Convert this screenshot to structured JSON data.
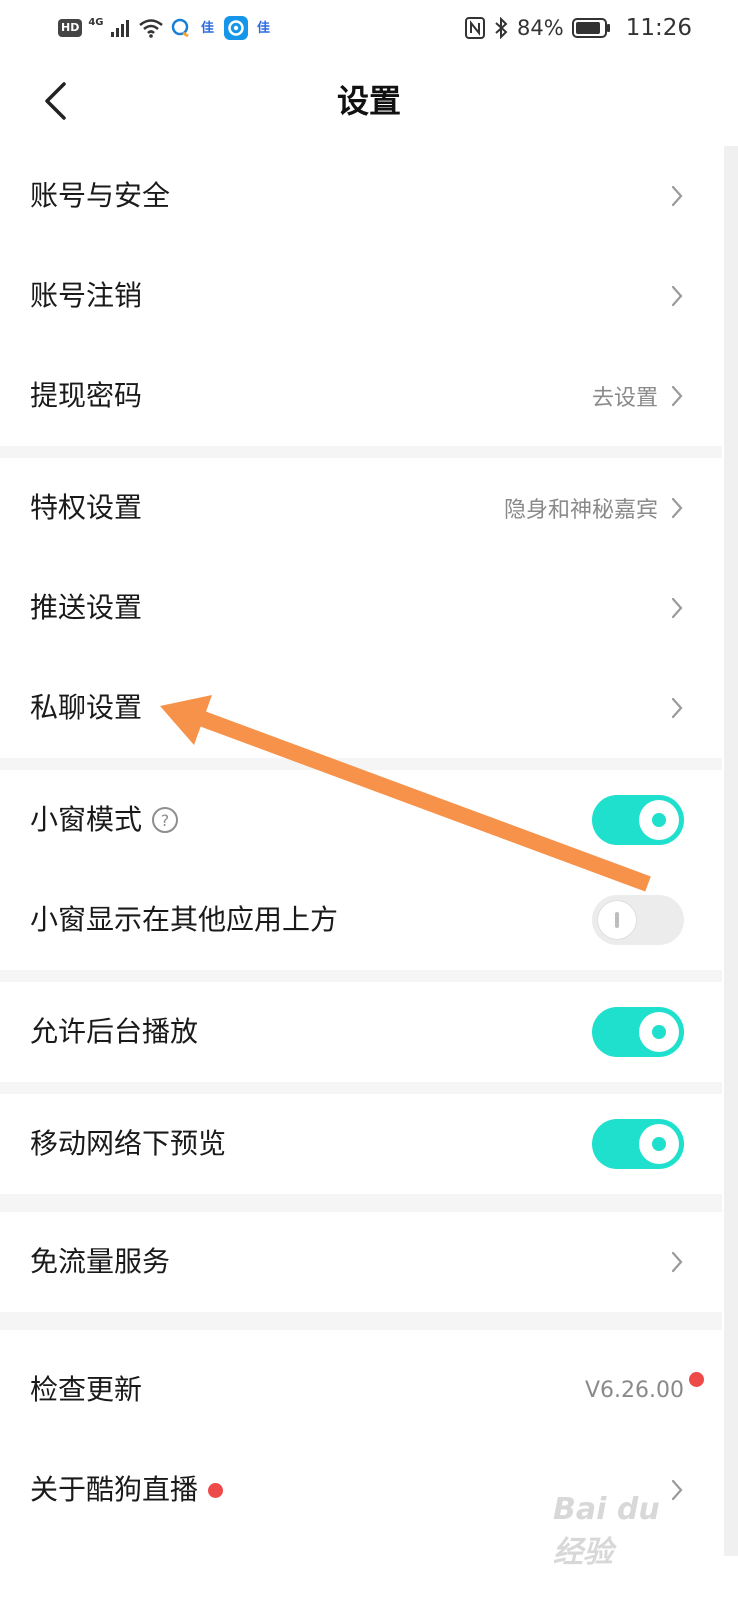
{
  "status_bar": {
    "hd": "HD",
    "network": "4G",
    "app_icon_1": "佳",
    "app_icon_2": "佳",
    "battery": "84%",
    "time": "11:26"
  },
  "header": {
    "title": "设置"
  },
  "sections": {
    "account_security": "账号与安全",
    "account_cancel": "账号注销",
    "withdraw_password": "提现密码",
    "withdraw_password_value": "去设置",
    "privilege": "特权设置",
    "privilege_value": "隐身和神秘嘉宾",
    "push": "推送设置",
    "private_chat": "私聊设置",
    "mini_window": "小窗模式",
    "help_glyph": "?",
    "mini_window_overlay": "小窗显示在其他应用上方",
    "background_play": "允许后台播放",
    "mobile_preview": "移动网络下预览",
    "free_data": "免流量服务",
    "check_update": "检查更新",
    "version": "V6.26.00",
    "about": "关于酷狗直播"
  },
  "toggles": {
    "mini_window": true,
    "mini_window_overlay": false,
    "background_play": true,
    "mobile_preview": true
  },
  "colors": {
    "toggle_on": "#1ee0cc",
    "toggle_off": "#ececec",
    "red_dot": "#ee4a4a",
    "arrow": "#f7924a"
  },
  "icons": {
    "back": "chevron-left-icon",
    "row_arrow": "chevron-right-icon",
    "help": "question-circle-icon"
  },
  "watermark": {
    "text": "Bai du 经验"
  }
}
